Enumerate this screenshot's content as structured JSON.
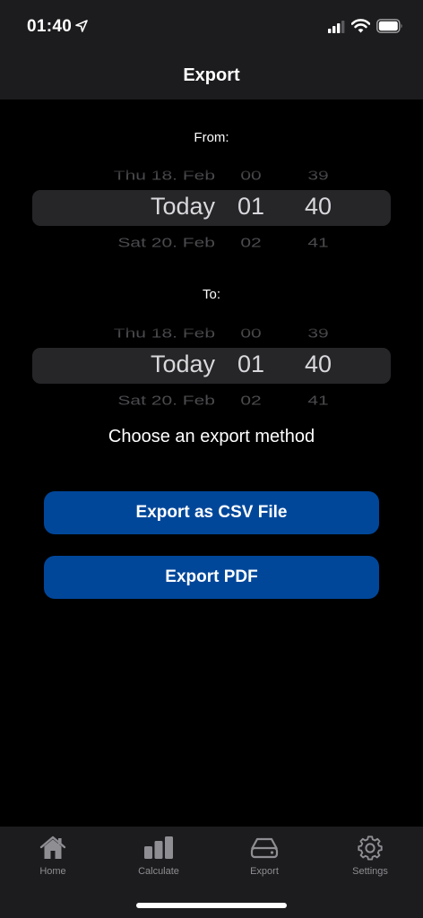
{
  "status_bar": {
    "time": "01:40"
  },
  "nav": {
    "title": "Export"
  },
  "from_picker": {
    "label": "From:",
    "above": {
      "date": "Thu 18. Feb",
      "hour": "00",
      "minute": "39"
    },
    "selected": {
      "date": "Today",
      "hour": "01",
      "minute": "40"
    },
    "below": {
      "date": "Sat 20. Feb",
      "hour": "02",
      "minute": "41"
    }
  },
  "to_picker": {
    "label": "To:",
    "above": {
      "date": "Thu 18. Feb",
      "hour": "00",
      "minute": "39"
    },
    "selected": {
      "date": "Today",
      "hour": "01",
      "minute": "40"
    },
    "below": {
      "date": "Sat 20. Feb",
      "hour": "02",
      "minute": "41"
    }
  },
  "export": {
    "prompt": "Choose an export method",
    "csv_label": "Export as CSV File",
    "pdf_label": "Export PDF"
  },
  "tabs": [
    {
      "label": "Home",
      "icon": "home-icon"
    },
    {
      "label": "Calculate",
      "icon": "bar-chart-icon"
    },
    {
      "label": "Export",
      "icon": "drive-icon"
    },
    {
      "label": "Settings",
      "icon": "gear-icon"
    }
  ],
  "colors": {
    "button": "#00479a",
    "bar_bg": "#1c1c1e",
    "tab_icon": "#8e8e93"
  }
}
